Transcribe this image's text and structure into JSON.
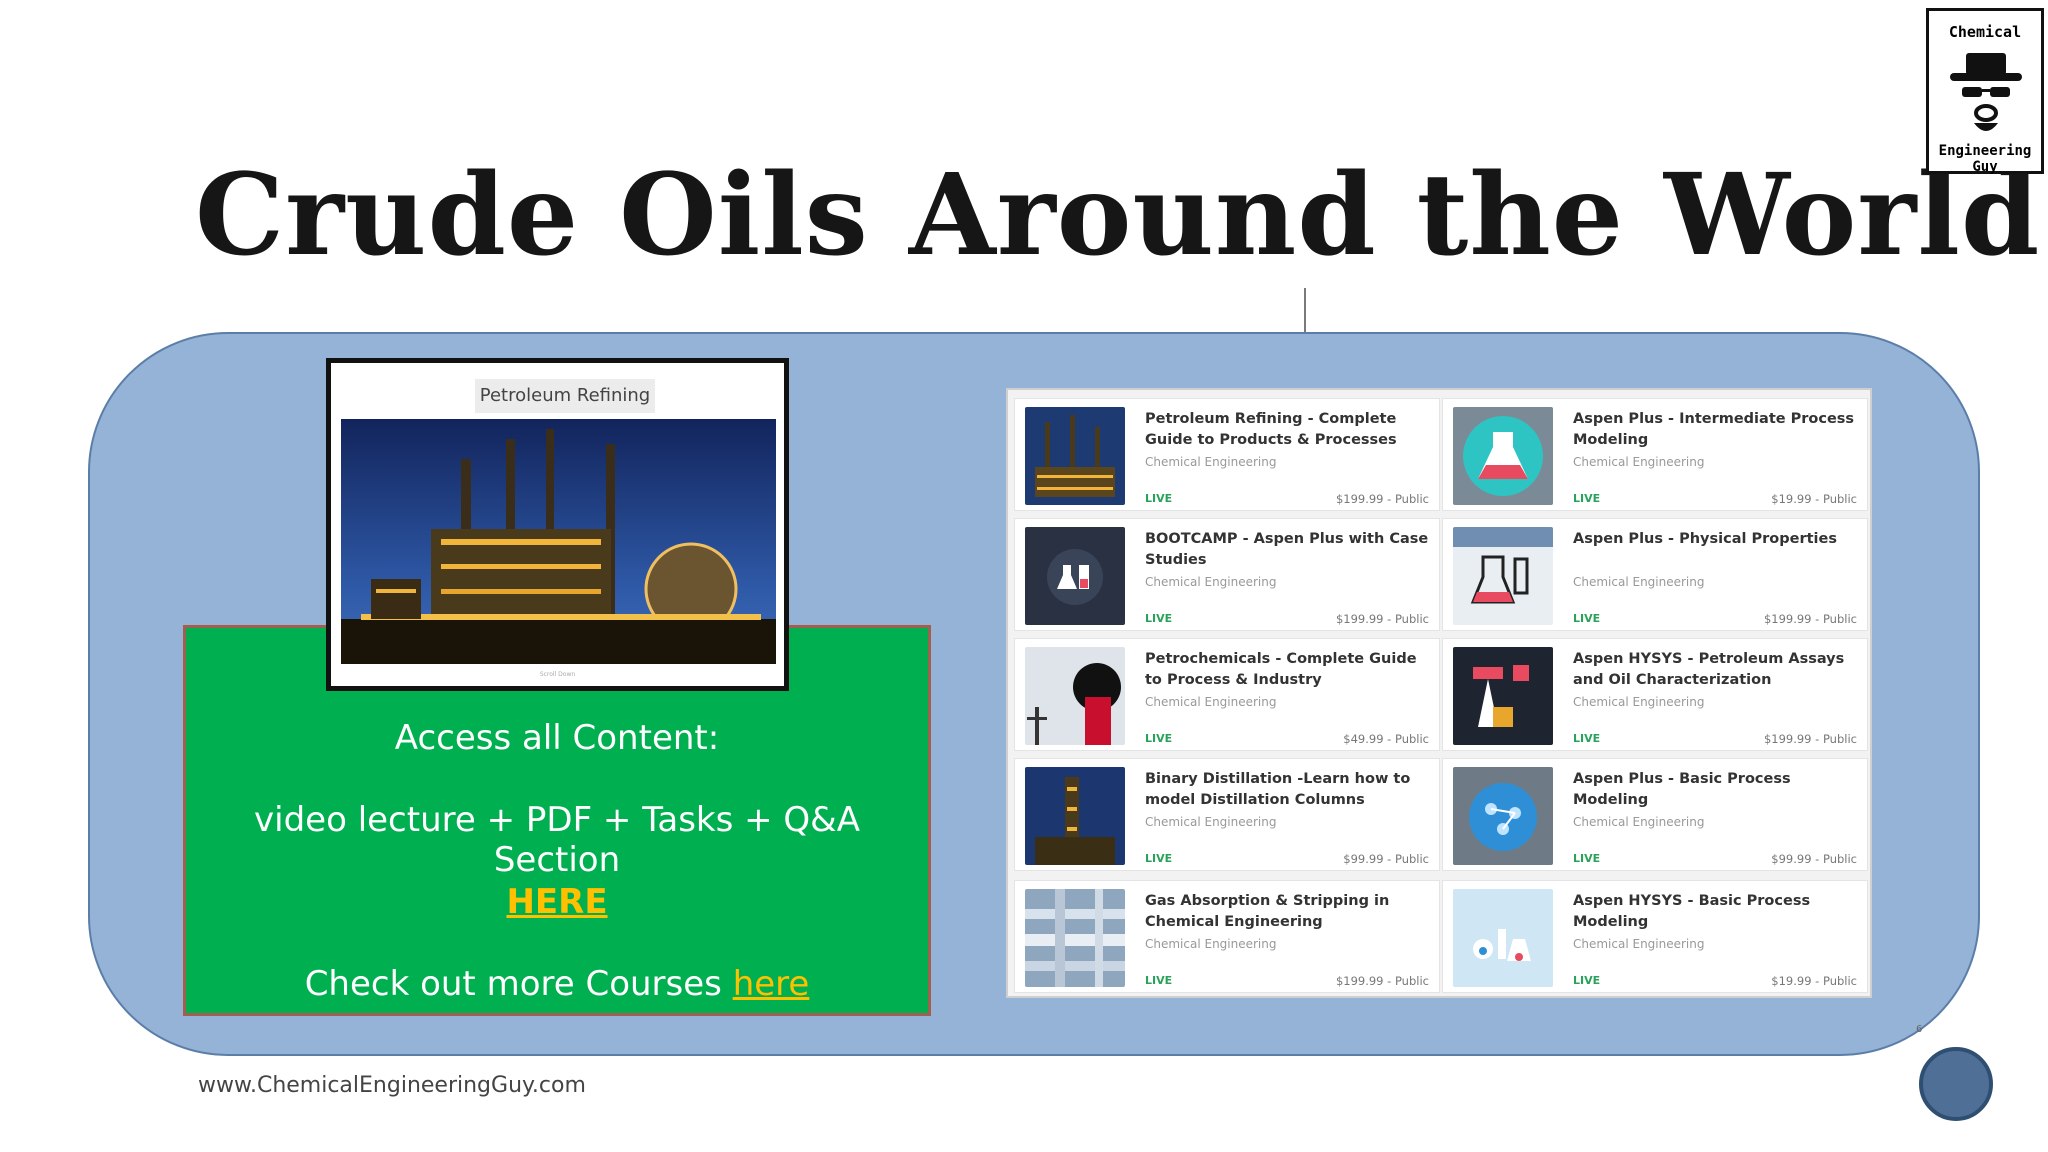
{
  "slide": {
    "title": "Crude Oils Around the World",
    "footer_url": "www.ChemicalEngineeringGuy.com",
    "page_number": "6"
  },
  "logo": {
    "line1": "Chemical",
    "line2": "Engineering Guy"
  },
  "preview": {
    "tag": "Petroleum Refining",
    "caption": "Scroll Down"
  },
  "promo": {
    "line1": "Access all Content:",
    "line2": "video lecture + PDF + Tasks + Q&A Section",
    "link": "HERE",
    "line4_prefix": "Check out more Courses",
    "line4_link": "here"
  },
  "courses": [
    {
      "title": "Petroleum Refining - Complete Guide to Products & Processes",
      "category": "Chemical Engineering",
      "status": "LIVE",
      "price": "$199.99 - Public",
      "thumb": "refinery"
    },
    {
      "title": "Aspen Plus - Intermediate Process Modeling",
      "category": "Chemical Engineering",
      "status": "LIVE",
      "price": "$19.99 - Public",
      "thumb": "flask"
    },
    {
      "title": "BOOTCAMP - Aspen Plus with Case Studies",
      "category": "Chemical Engineering",
      "status": "LIVE",
      "price": "$199.99 - Public",
      "thumb": "bootcamp"
    },
    {
      "title": "Aspen Plus - Physical Properties",
      "category": "Chemical Engineering",
      "status": "LIVE",
      "price": "$199.99 - Public",
      "thumb": "beaker"
    },
    {
      "title": "Petrochemicals - Complete Guide to Process & Industry",
      "category": "Chemical Engineering",
      "status": "LIVE",
      "price": "$49.99 - Public",
      "thumb": "oilfield"
    },
    {
      "title": "Aspen HYSYS - Petroleum Assays and Oil Characterization",
      "category": "Chemical Engineering",
      "status": "LIVE",
      "price": "$199.99 - Public",
      "thumb": "pumpjack"
    },
    {
      "title": "Binary Distillation -Learn how to model Distillation Columns",
      "category": "Chemical Engineering",
      "status": "LIVE",
      "price": "$99.99 - Public",
      "thumb": "column"
    },
    {
      "title": "Aspen Plus - Basic Process Modeling",
      "category": "Chemical Engineering",
      "status": "LIVE",
      "price": "$99.99 - Public",
      "thumb": "molecule"
    },
    {
      "title": "Gas Absorption & Stripping in Chemical Engineering",
      "category": "Chemical Engineering",
      "status": "LIVE",
      "price": "$199.99 - Public",
      "thumb": "pipes"
    },
    {
      "title": "Aspen HYSYS - Basic Process Modeling",
      "category": "Chemical Engineering",
      "status": "LIVE",
      "price": "$19.99 - Public",
      "thumb": "labware"
    }
  ],
  "colors": {
    "panel": "#95b3d7",
    "promo_bg": "#00b050",
    "link": "#ffc000",
    "live": "#2aa35a"
  }
}
